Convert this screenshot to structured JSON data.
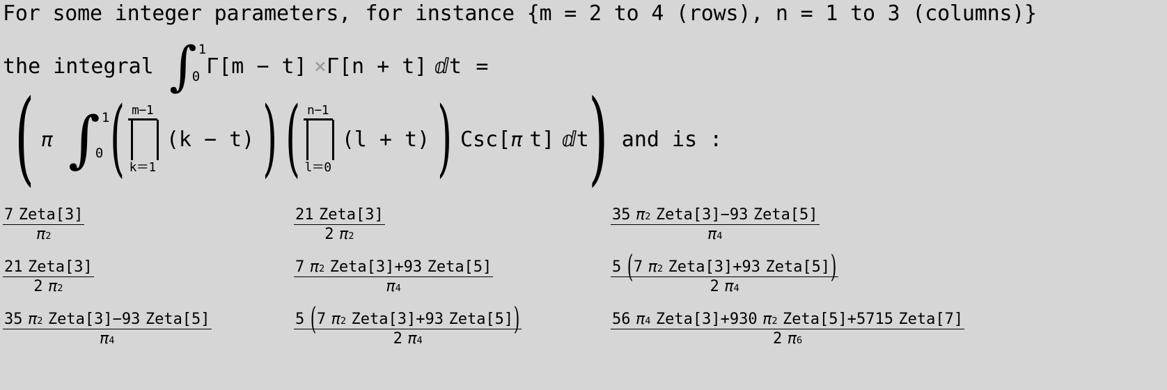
{
  "document": {
    "background_color": "#d6d6d6",
    "text_color": "#000000",
    "muted_color": "#9a9a9a"
  },
  "prose": {
    "line1_a": "For some integer parameters,",
    "line1_b": "for instance {m = 2 to 4 (rows), n = 1 to 3 (columns)}",
    "line2_lead": "the integral",
    "line2_integrand_a": "Γ[m − t]",
    "line2_times": "×",
    "line2_integrand_b": "Γ[n + t]",
    "line2_differential": "ⅆt",
    "line2_equals": "=",
    "line3_tail": "and is :"
  },
  "formula": {
    "integral_lower": "0",
    "integral_upper": "1",
    "pi": "π",
    "product1_upper": "m−1",
    "product1_lower": "k＝1",
    "product1_body": "(k − t)",
    "product2_upper": "n−1",
    "product2_lower": "l＝0",
    "product2_body": "(l + t)",
    "csc": "Csc[",
    "csc_arg_pi": "π",
    "csc_arg_t": "t]",
    "differential": "ⅆt"
  },
  "matrix": {
    "rows": 3,
    "cols": 3,
    "row_param": "m",
    "col_param": "n",
    "cells": [
      [
        {
          "num": "7 Zeta[3]",
          "den": "π",
          "den_exp": "2",
          "den_coef": ""
        },
        {
          "num": "21 Zeta[3]",
          "den": "π",
          "den_exp": "2",
          "den_coef": "2"
        },
        {
          "num": "35 π² Zeta[3]−93 Zeta[5]",
          "den": "π",
          "den_exp": "4",
          "den_coef": ""
        }
      ],
      [
        {
          "num": "21 Zeta[3]",
          "den": "π",
          "den_exp": "2",
          "den_coef": "2"
        },
        {
          "num": "7 π² Zeta[3]+93 Zeta[5]",
          "den": "π",
          "den_exp": "4",
          "den_coef": ""
        },
        {
          "num": "5 (7 π² Zeta[3]+93 Zeta[5])",
          "den": "π",
          "den_exp": "4",
          "den_coef": "2"
        }
      ],
      [
        {
          "num": "35 π² Zeta[3]−93 Zeta[5]",
          "den": "π",
          "den_exp": "4",
          "den_coef": ""
        },
        {
          "num": "5 (7 π² Zeta[3]+93 Zeta[5])",
          "den": "π",
          "den_exp": "4",
          "den_coef": "2"
        },
        {
          "num": "56 π⁴ Zeta[3]+930 π² Zeta[5]+5715 Zeta[7]",
          "den": "π",
          "den_exp": "6",
          "den_coef": "2"
        }
      ]
    ],
    "cell_parts": {
      "r1c1": {
        "n_coef": "7",
        "n_fn": "Zeta[3]"
      },
      "r1c2": {
        "n_coef": "21",
        "n_fn": "Zeta[3]"
      },
      "r1c3": {
        "n_coef": "35",
        "n_pi_exp": "2",
        "n_fn1": "Zeta[3]",
        "n_op": "−",
        "n_coef2": "93",
        "n_fn2": "Zeta[5]"
      },
      "r2c1": {
        "n_coef": "21",
        "n_fn": "Zeta[3]"
      },
      "r2c2": {
        "n_coef": "7",
        "n_pi_exp": "2",
        "n_fn1": "Zeta[3]",
        "n_op": "+",
        "n_coef2": "93",
        "n_fn2": "Zeta[5]"
      },
      "r2c3": {
        "n_outer": "5",
        "n_coef": "7",
        "n_pi_exp": "2",
        "n_fn1": "Zeta[3]",
        "n_op": "+",
        "n_coef2": "93",
        "n_fn2": "Zeta[5]"
      },
      "r3c1": {
        "n_coef": "35",
        "n_pi_exp": "2",
        "n_fn1": "Zeta[3]",
        "n_op": "−",
        "n_coef2": "93",
        "n_fn2": "Zeta[5]"
      },
      "r3c2": {
        "n_outer": "5",
        "n_coef": "7",
        "n_pi_exp": "2",
        "n_fn1": "Zeta[3]",
        "n_op": "+",
        "n_coef2": "93",
        "n_fn2": "Zeta[5]"
      },
      "r3c3": {
        "n_coef": "56",
        "n_pi_exp": "4",
        "n_fn1": "Zeta[3]",
        "n_op": "+",
        "n_coef2": "930",
        "n_pi_exp2": "2",
        "n_fn2": "Zeta[5]",
        "n_op2": "+",
        "n_coef3": "5715",
        "n_fn3": "Zeta[7]"
      }
    }
  }
}
